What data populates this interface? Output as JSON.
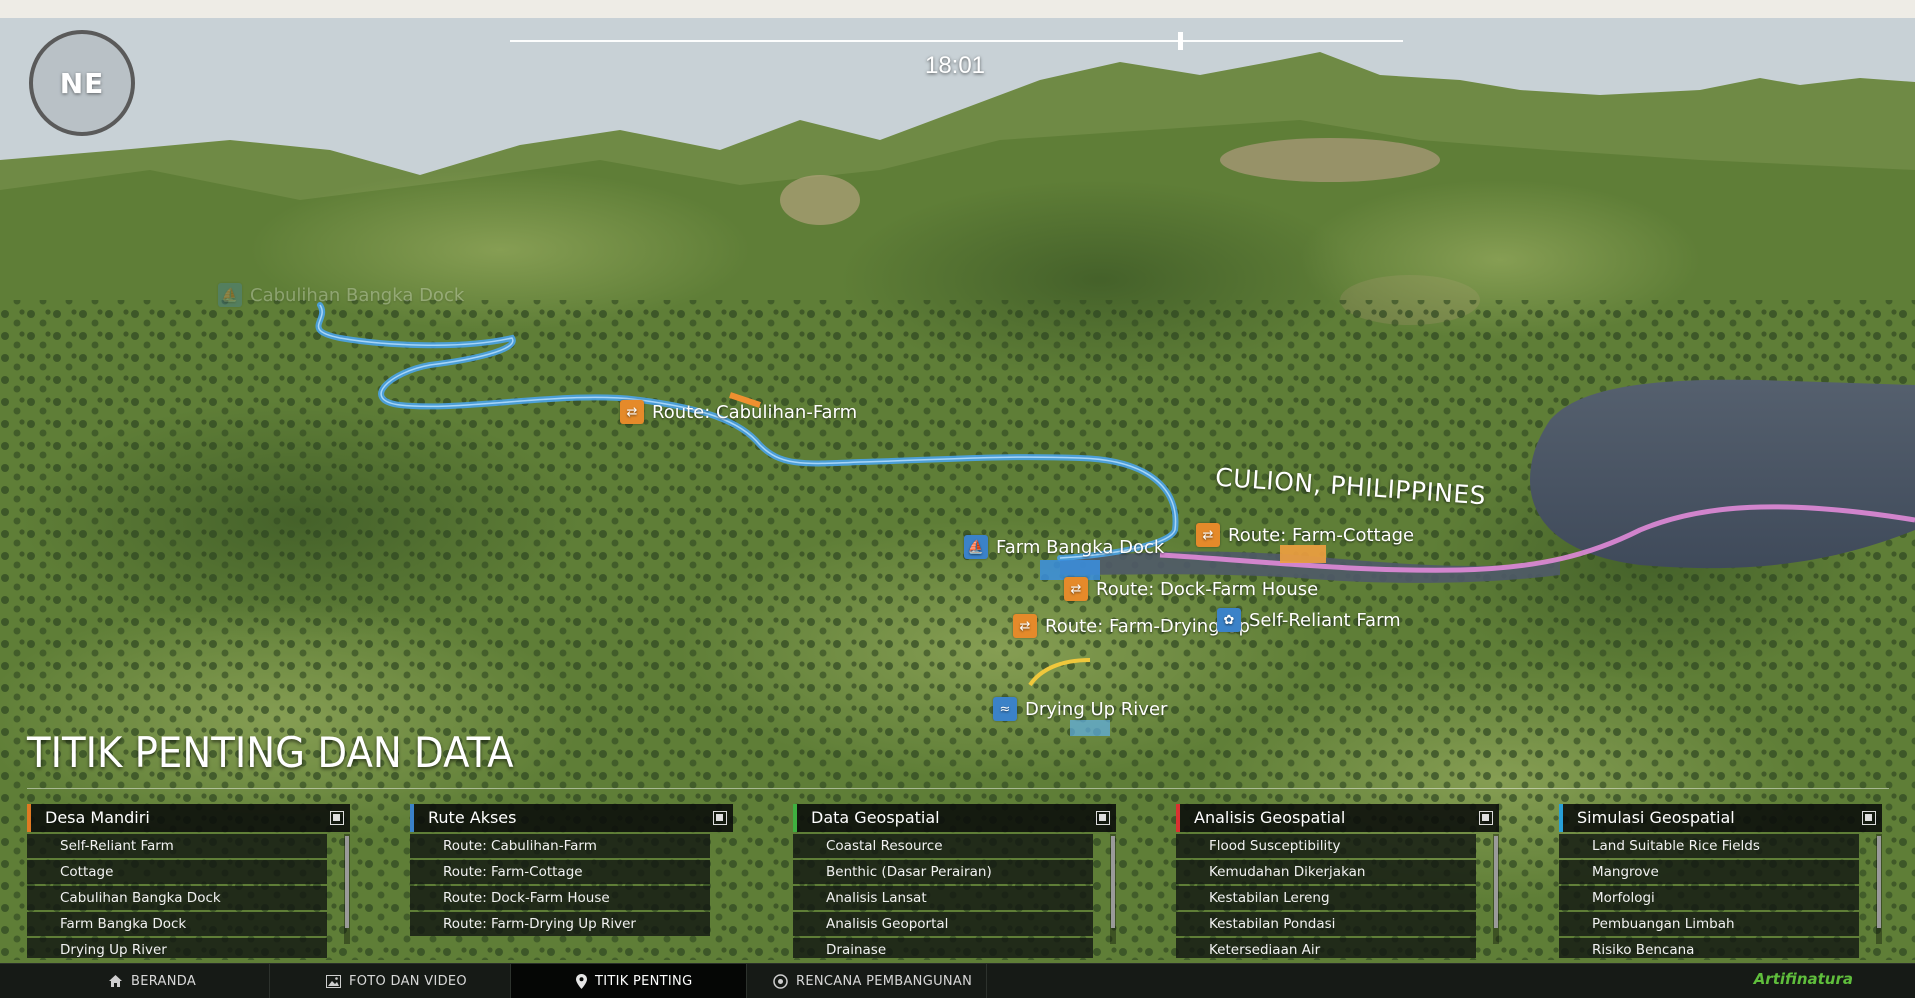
{
  "hud": {
    "compass_heading": "NE",
    "time": "18:01",
    "timeline_progress": 0.75
  },
  "map": {
    "region_label": "CULION, PHILIPPINES",
    "markers": [
      {
        "label": "Cabulihan Bangka Dock",
        "icon": "dock-icon",
        "color": "blue",
        "faded": true
      },
      {
        "label": "Route: Cabulihan-Farm",
        "icon": "route-icon",
        "color": "orange"
      },
      {
        "label": "Farm Bangka Dock",
        "icon": "dock-icon",
        "color": "blue"
      },
      {
        "label": "Route: Farm-Cottage",
        "icon": "route-icon",
        "color": "orange"
      },
      {
        "label": "Route: Dock-Farm House",
        "icon": "route-icon",
        "color": "orange"
      },
      {
        "label": "Route: Farm-Drying Up",
        "icon": "route-icon",
        "color": "orange"
      },
      {
        "label": "Self-Reliant Farm",
        "icon": "farm-icon",
        "color": "blue"
      },
      {
        "label": "Drying Up River",
        "icon": "river-icon",
        "color": "blue"
      }
    ]
  },
  "section_title": "TITIK PENTING DAN DATA",
  "panels": [
    {
      "title": "Desa Mandiri",
      "accent": "#e07a22",
      "items": [
        "Self-Reliant Farm",
        "Cottage",
        "Cabulihan Bangka Dock",
        "Farm Bangka Dock",
        "Drying Up River"
      ]
    },
    {
      "title": "Rute Akses",
      "accent": "#3b82c8",
      "items": [
        "Route: Cabulihan-Farm",
        "Route: Farm-Cottage",
        "Route: Dock-Farm House",
        "Route: Farm-Drying Up River"
      ]
    },
    {
      "title": "Data Geospatial",
      "accent": "#3fb040",
      "items": [
        "Coastal Resource",
        "Benthic (Dasar Perairan)",
        "Analisis Lansat",
        "Analisis Geoportal",
        "Drainase"
      ]
    },
    {
      "title": "Analisis Geospatial",
      "accent": "#d93030",
      "items": [
        "Flood Susceptibility",
        "Kemudahan Dikerjakan",
        "Kestabilan Lereng",
        "Kestabilan Pondasi",
        "Ketersediaan Air"
      ]
    },
    {
      "title": "Simulasi Geospatial",
      "accent": "#28a0d8",
      "items": [
        "Land Suitable Rice Fields",
        "Mangrove",
        "Morfologi",
        "Pembuangan Limbah",
        "Risiko Bencana"
      ]
    }
  ],
  "nav": {
    "items": [
      {
        "label": "BERANDA",
        "icon": "home-icon"
      },
      {
        "label": "FOTO DAN VIDEO",
        "icon": "image-icon"
      },
      {
        "label": "TITIK PENTING",
        "icon": "pin-icon",
        "active": true
      },
      {
        "label": "RENCANA PEMBANGUNAN",
        "icon": "compass-icon"
      }
    ],
    "brand": "Artifinatura"
  }
}
